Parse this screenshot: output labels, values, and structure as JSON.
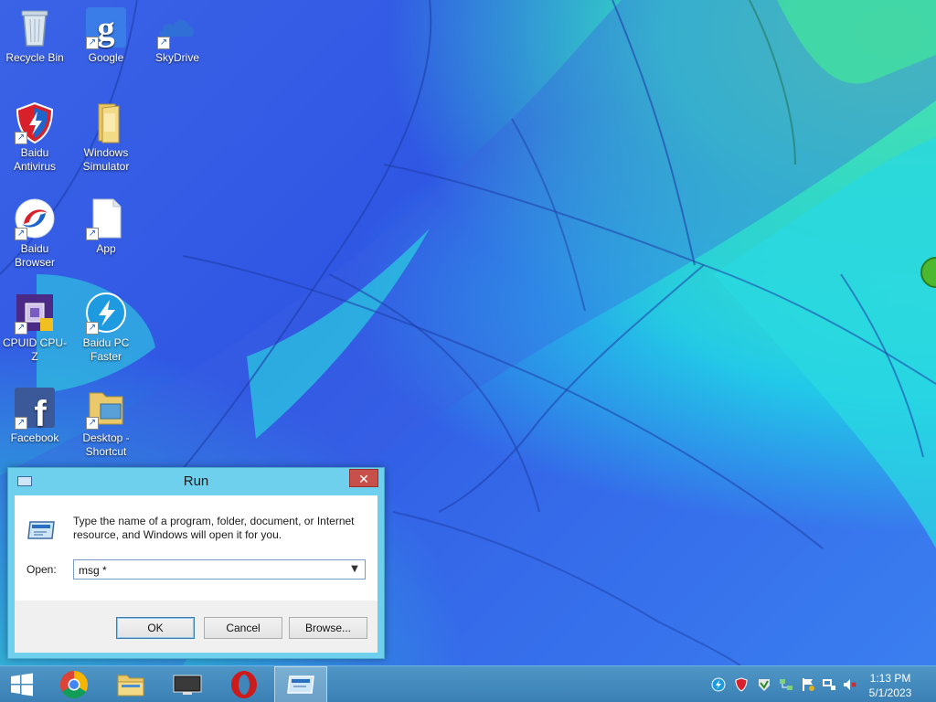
{
  "desktop": {
    "icons": [
      {
        "label": "Recycle Bin",
        "icon": "recycle-bin-icon",
        "shortcut": false
      },
      {
        "label": "Google",
        "icon": "google-icon",
        "shortcut": true
      },
      {
        "label": "SkyDrive",
        "icon": "skydrive-icon",
        "shortcut": true
      },
      {
        "label": "Baidu Antivirus",
        "icon": "baidu-antivirus-icon",
        "shortcut": true
      },
      {
        "label": "Windows Simulator",
        "icon": "folder-icon",
        "shortcut": false
      },
      {
        "label": "Baidu Browser",
        "icon": "baidu-browser-icon",
        "shortcut": true
      },
      {
        "label": "App",
        "icon": "file-icon",
        "shortcut": true
      },
      {
        "label": "CPUID CPU-Z",
        "icon": "cpu-z-icon",
        "shortcut": true
      },
      {
        "label": "Baidu PC Faster",
        "icon": "baidu-pc-faster-icon",
        "shortcut": true
      },
      {
        "label": "Facebook",
        "icon": "facebook-icon",
        "shortcut": true
      },
      {
        "label": "Desktop - Shortcut",
        "icon": "desktop-folder-icon",
        "shortcut": true
      }
    ]
  },
  "run_dialog": {
    "title": "Run",
    "close_label": "✕",
    "description": "Type the name of a program, folder, document, or Internet resource, and Windows will open it for you.",
    "open_label": "Open:",
    "open_value": "msg *",
    "ok_label": "OK",
    "cancel_label": "Cancel",
    "browse_label": "Browse..."
  },
  "taskbar": {
    "items": [
      {
        "name": "start-button",
        "icon": "windows-logo-icon"
      },
      {
        "name": "chrome",
        "icon": "chrome-icon"
      },
      {
        "name": "file-explorer",
        "icon": "file-explorer-icon"
      },
      {
        "name": "display",
        "icon": "monitor-icon"
      },
      {
        "name": "opera",
        "icon": "opera-icon"
      },
      {
        "name": "run",
        "icon": "run-icon"
      }
    ],
    "tray": [
      "baidu-pc-faster-tray-icon",
      "baidu-antivirus-tray-icon",
      "security-tray-icon",
      "network-share-tray-icon",
      "action-center-flag-icon",
      "network-icon",
      "volume-muted-icon"
    ],
    "clock": {
      "time": "1:13 PM",
      "date": "5/1/2023"
    }
  },
  "colors": {
    "taskbar": "#3f86bb",
    "dialog_frame": "#6fd0ee",
    "close_button": "#c7504a"
  }
}
